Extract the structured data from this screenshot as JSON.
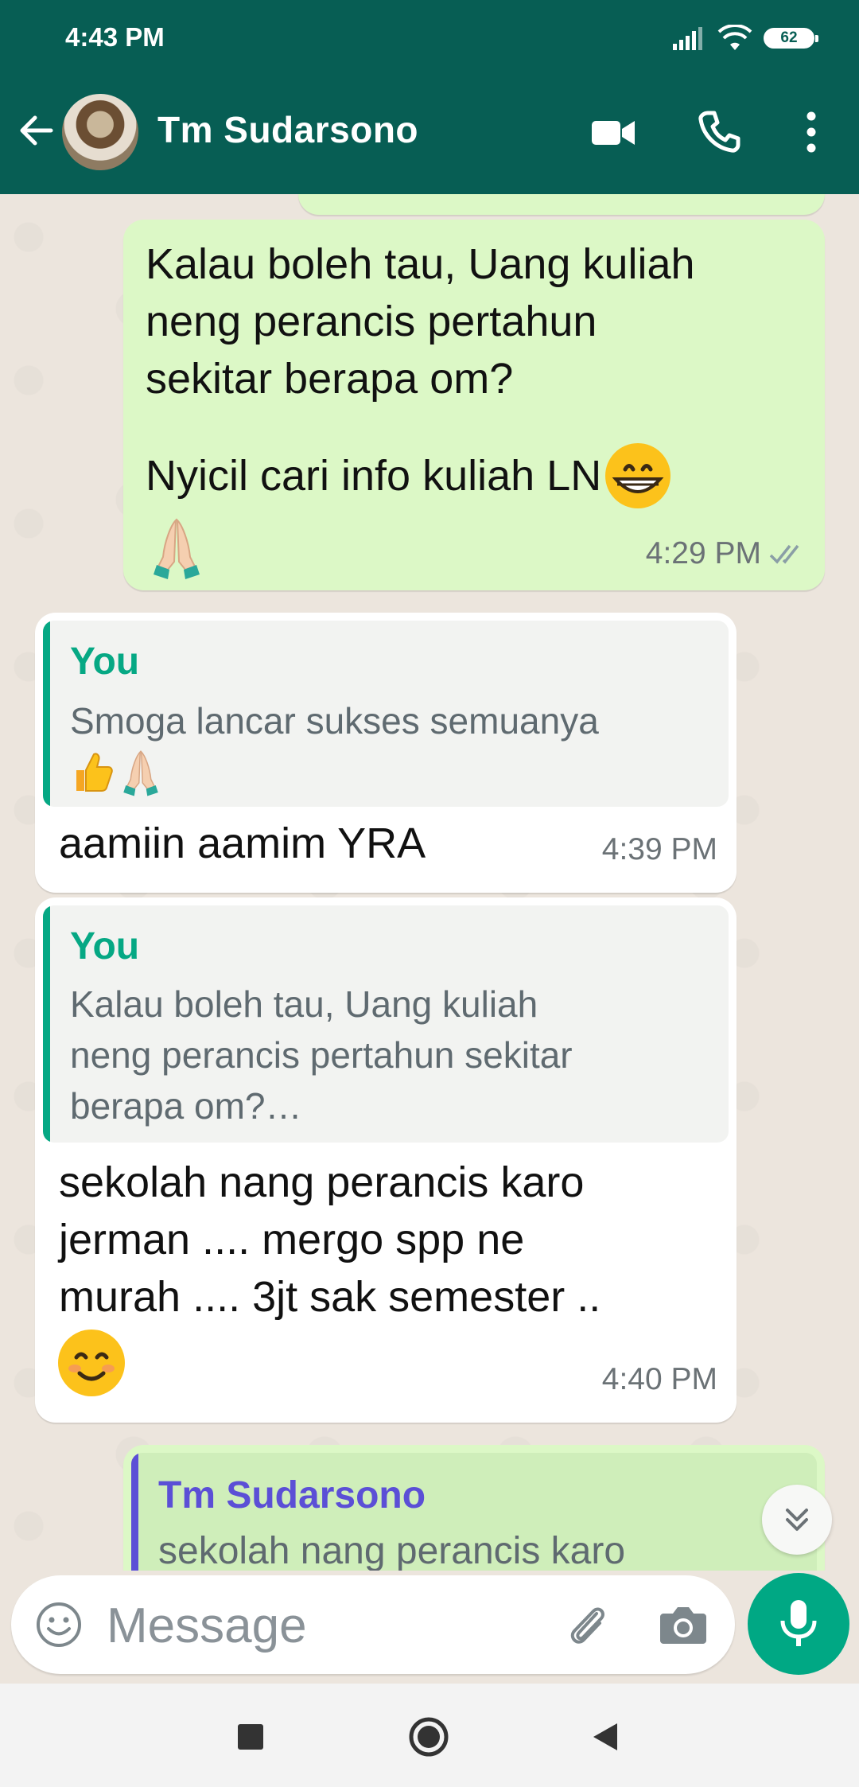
{
  "status_bar": {
    "time": "4:43 PM",
    "battery": "62"
  },
  "header": {
    "contact_name": "Tm Sudarsono"
  },
  "messages": [
    {
      "type": "outgoing",
      "text_lines": [
        "Kalau boleh tau, Uang kuliah",
        "neng perancis pertahun",
        "sekitar berapa om?"
      ],
      "text2": "Nyicil cari info kuliah LN",
      "time": "4:29 PM"
    },
    {
      "type": "incoming",
      "quote_author": "You",
      "quote_text": "Smoga lancar sukses semuanya",
      "text": "aamiin aamim YRA",
      "time": "4:39 PM"
    },
    {
      "type": "incoming",
      "quote_author": "You",
      "quote_lines": [
        "Kalau boleh tau, Uang kuliah",
        "neng perancis pertahun sekitar",
        "berapa om?…"
      ],
      "text_lines": [
        "sekolah nang perancis karo",
        "jerman .... mergo spp ne",
        "murah .... 3jt sak semester .."
      ],
      "time": "4:40 PM"
    },
    {
      "type": "outgoing",
      "quote_author": "Tm Sudarsono",
      "quote_text": "sekolah nang perancis karo"
    }
  ],
  "composer": {
    "placeholder": "Message"
  },
  "colors": {
    "header": "#075e54",
    "outgoing": "#dcf8c6",
    "incoming": "#ffffff",
    "accent": "#00a884",
    "quote_other": "#5b4fd6"
  },
  "icons": [
    "back-arrow-icon",
    "video-call-icon",
    "phone-icon",
    "more-vert-icon",
    "emoji-icon",
    "attach-icon",
    "camera-icon",
    "mic-icon",
    "scroll-down-icon",
    "read-ticks-icon",
    "nav-square-icon",
    "nav-circle-icon",
    "nav-back-icon"
  ]
}
